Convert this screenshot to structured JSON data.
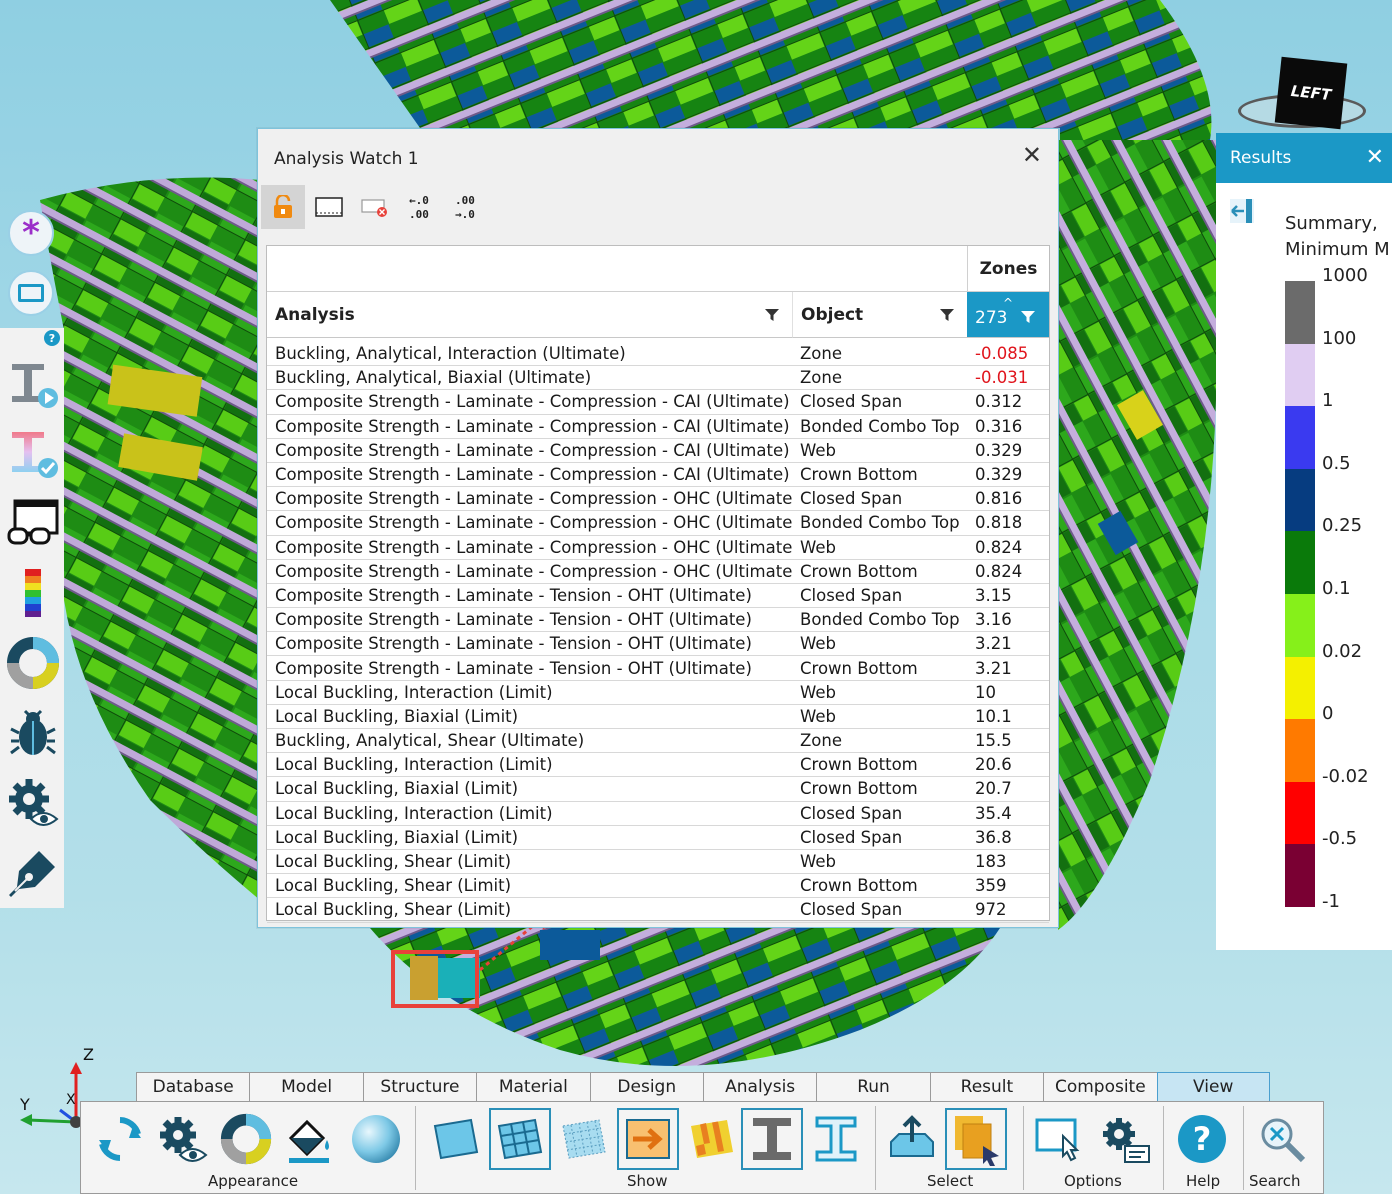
{
  "dialog": {
    "title": "Analysis Watch 1",
    "close_label": "✕",
    "toolbar": {
      "lock_icon": "lock-open-icon",
      "select_icon": "selection-box-icon",
      "clear_icon": "clear-selection-icon",
      "decrease_decimals_label": "←.0\n.00",
      "increase_decimals_label": ".00\n→.0"
    },
    "columns": {
      "analysis": "Analysis",
      "object": "Object",
      "group": "Zones",
      "value": "273"
    },
    "rows": [
      {
        "analysis": "Buckling, Analytical, Interaction (Ultimate)",
        "object": "Zone",
        "value": "-0.085"
      },
      {
        "analysis": "Buckling, Analytical, Biaxial (Ultimate)",
        "object": "Zone",
        "value": "-0.031"
      },
      {
        "analysis": "Composite Strength - Laminate - Compression - CAI (Ultimate)",
        "object": "Closed Span",
        "value": "0.312"
      },
      {
        "analysis": "Composite Strength - Laminate - Compression - CAI (Ultimate)",
        "object": "Bonded Combo Top",
        "value": "0.316"
      },
      {
        "analysis": "Composite Strength - Laminate - Compression - CAI (Ultimate)",
        "object": "Web",
        "value": "0.329"
      },
      {
        "analysis": "Composite Strength - Laminate - Compression - CAI (Ultimate)",
        "object": "Crown Bottom",
        "value": "0.329"
      },
      {
        "analysis": "Composite Strength - Laminate - Compression - OHC (Ultimate)",
        "object": "Closed Span",
        "value": "0.816"
      },
      {
        "analysis": "Composite Strength - Laminate - Compression - OHC (Ultimate)",
        "object": "Bonded Combo Top",
        "value": "0.818"
      },
      {
        "analysis": "Composite Strength - Laminate - Compression - OHC (Ultimate)",
        "object": "Web",
        "value": "0.824"
      },
      {
        "analysis": "Composite Strength - Laminate - Compression - OHC (Ultimate)",
        "object": "Crown Bottom",
        "value": "0.824"
      },
      {
        "analysis": "Composite Strength - Laminate - Tension - OHT (Ultimate)",
        "object": "Closed Span",
        "value": "3.15"
      },
      {
        "analysis": "Composite Strength - Laminate - Tension - OHT (Ultimate)",
        "object": "Bonded Combo Top",
        "value": "3.16"
      },
      {
        "analysis": "Composite Strength - Laminate - Tension - OHT (Ultimate)",
        "object": "Web",
        "value": "3.21"
      },
      {
        "analysis": "Composite Strength - Laminate - Tension - OHT (Ultimate)",
        "object": "Crown Bottom",
        "value": "3.21"
      },
      {
        "analysis": "Local Buckling, Interaction (Limit)",
        "object": "Web",
        "value": "10"
      },
      {
        "analysis": "Local Buckling, Biaxial (Limit)",
        "object": "Web",
        "value": "10.1"
      },
      {
        "analysis": "Buckling, Analytical, Shear (Ultimate)",
        "object": "Zone",
        "value": "15.5"
      },
      {
        "analysis": "Local Buckling, Interaction (Limit)",
        "object": "Crown Bottom",
        "value": "20.6"
      },
      {
        "analysis": "Local Buckling, Biaxial (Limit)",
        "object": "Crown Bottom",
        "value": "20.7"
      },
      {
        "analysis": "Local Buckling, Interaction (Limit)",
        "object": "Closed Span",
        "value": "35.4"
      },
      {
        "analysis": "Local Buckling, Biaxial (Limit)",
        "object": "Closed Span",
        "value": "36.8"
      },
      {
        "analysis": "Local Buckling, Shear (Limit)",
        "object": "Web",
        "value": "183"
      },
      {
        "analysis": "Local Buckling, Shear (Limit)",
        "object": "Crown Bottom",
        "value": "359"
      },
      {
        "analysis": "Local Buckling, Shear (Limit)",
        "object": "Closed Span",
        "value": "972"
      }
    ]
  },
  "results": {
    "title": "Results",
    "close_label": "✕",
    "subtitle_line1": "Summary,",
    "subtitle_line2": "Minimum M",
    "legend": [
      {
        "label": "1000",
        "color": "#6b6b6b"
      },
      {
        "label": "100",
        "color": "#e0cdf2"
      },
      {
        "label": "1",
        "color": "#3a3af0"
      },
      {
        "label": "0.5",
        "color": "#063c80"
      },
      {
        "label": "0.25",
        "color": "#0a7a0a"
      },
      {
        "label": "0.1",
        "color": "#86f01a"
      },
      {
        "label": "0.02",
        "color": "#f4f000"
      },
      {
        "label": "0",
        "color": "#ff7a00"
      },
      {
        "label": "-0.02",
        "color": "#ff0000"
      },
      {
        "label": "-0.5",
        "color": "#7a0033"
      },
      {
        "label": "-1",
        "color": ""
      }
    ]
  },
  "viewcube": {
    "face_label": "LEFT"
  },
  "axes": {
    "z": "Z",
    "y": "Y",
    "x": "X"
  },
  "left_toolbar": [
    "asterisk-icon",
    "window-icon",
    "help-badge-icon",
    "ibeam-play-icon",
    "ibeam-check-icon",
    "glasses-window-icon",
    "color-scale-icon",
    "donut-icon",
    "bug-icon",
    "gear-eye-icon",
    "pen-nib-icon"
  ],
  "ribbon": {
    "tabs": [
      "Database",
      "Model",
      "Structure",
      "Material",
      "Design",
      "Analysis",
      "Run",
      "Result",
      "Composite",
      "View"
    ],
    "active_tab": "View",
    "groups": {
      "appearance": "Appearance",
      "show": "Show",
      "select": "Select",
      "options": "Options",
      "help": "Help",
      "search": "Search"
    }
  },
  "colors": {
    "accent": "#1b98c6",
    "negative": "#e0141c",
    "selection": "#e8413a"
  }
}
